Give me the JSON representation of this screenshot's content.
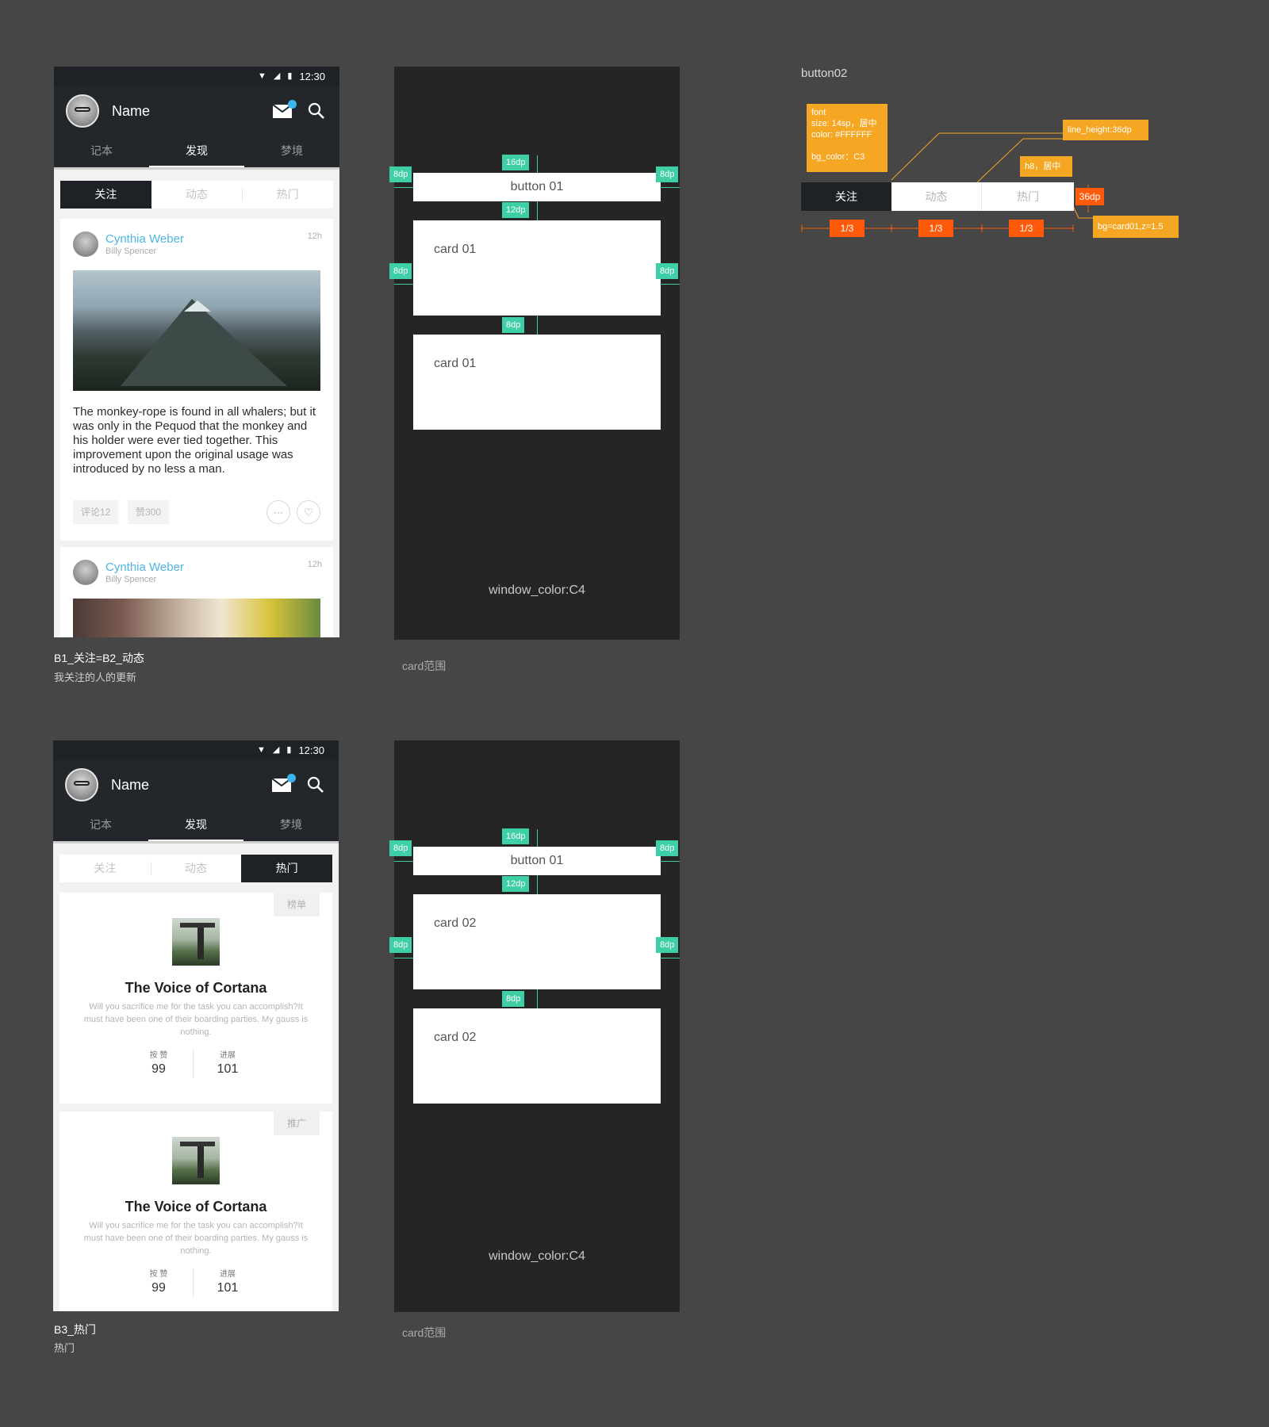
{
  "status_bar": {
    "time": "12:30"
  },
  "app_bar": {
    "user_name": "Name"
  },
  "main_tabs": [
    "记本",
    "发现",
    "梦境"
  ],
  "sub_tabs": [
    "关注",
    "动态",
    "热门"
  ],
  "screen1": {
    "caption_title": "B1_关注=B2_动态",
    "caption_sub": "我关注的人的更新",
    "posts": [
      {
        "author": "Cynthia Weber",
        "sub": "Billy Spencer",
        "time": "12h",
        "text": "The monkey-rope is found in all whalers; but it was only in the Pequod that the monkey and his holder were ever tied together. This improvement upon the original usage was introduced by no less a man.",
        "comments": "评论12",
        "likes": "赞300",
        "more": "···",
        "heart": "♡"
      },
      {
        "author": "Cynthia Weber",
        "sub": "Billy Spencer",
        "time": "12h"
      }
    ]
  },
  "screen2": {
    "caption_title": "B3_热门",
    "caption_sub": "热门",
    "cards": [
      {
        "tag": "榜单",
        "title": "The Voice of Cortana",
        "desc": "Will you sacrifice me for the task you can accomplish?It must have been one of their boarding parties. My gauss is nothing.",
        "stat1_label": "按 赞",
        "stat1_value": "99",
        "stat2_label": "进展",
        "stat2_value": "101"
      },
      {
        "tag": "推广",
        "title": "The Voice of Cortana",
        "desc": "Will you sacrifice me for the task you can accomplish?It must have been one of their boarding parties. My gauss is nothing.",
        "stat1_label": "按 赞",
        "stat1_value": "99",
        "stat2_label": "进展",
        "stat2_value": "101"
      }
    ]
  },
  "spec1": {
    "button": "button 01",
    "card1": "card 01",
    "card2": "card 01",
    "window": "window_color:C4",
    "caption": "card范围",
    "tags": {
      "top": "16dp",
      "gap1": "12dp",
      "gap2": "8dp",
      "side": "8dp"
    }
  },
  "spec2": {
    "button": "button 01",
    "card1": "card 02",
    "card2": "card 02",
    "window": "window_color:C4",
    "caption": "card范围",
    "tags": {
      "top": "16dp",
      "gap1": "12dp",
      "gap2": "8dp",
      "side": "8dp"
    }
  },
  "button02": {
    "title": "button02",
    "font_note": [
      "font",
      "size: 14sp，居中",
      "color: #FFFFFF",
      "",
      "bg_color：C3"
    ],
    "line_height_note": "line_height:36dp",
    "h8_note": "h8，居中",
    "height_note": "36dp",
    "bg_note": "bg=card01,z=1.5",
    "segments": [
      "关注",
      "动态",
      "热门"
    ],
    "fractions": [
      "1/3",
      "1/3",
      "1/3"
    ]
  },
  "colors": {
    "accent_teal": "#3ecfa6",
    "note_orange": "#f5a623",
    "note_red": "#ff5a0a",
    "link_blue": "#4db5e6"
  }
}
